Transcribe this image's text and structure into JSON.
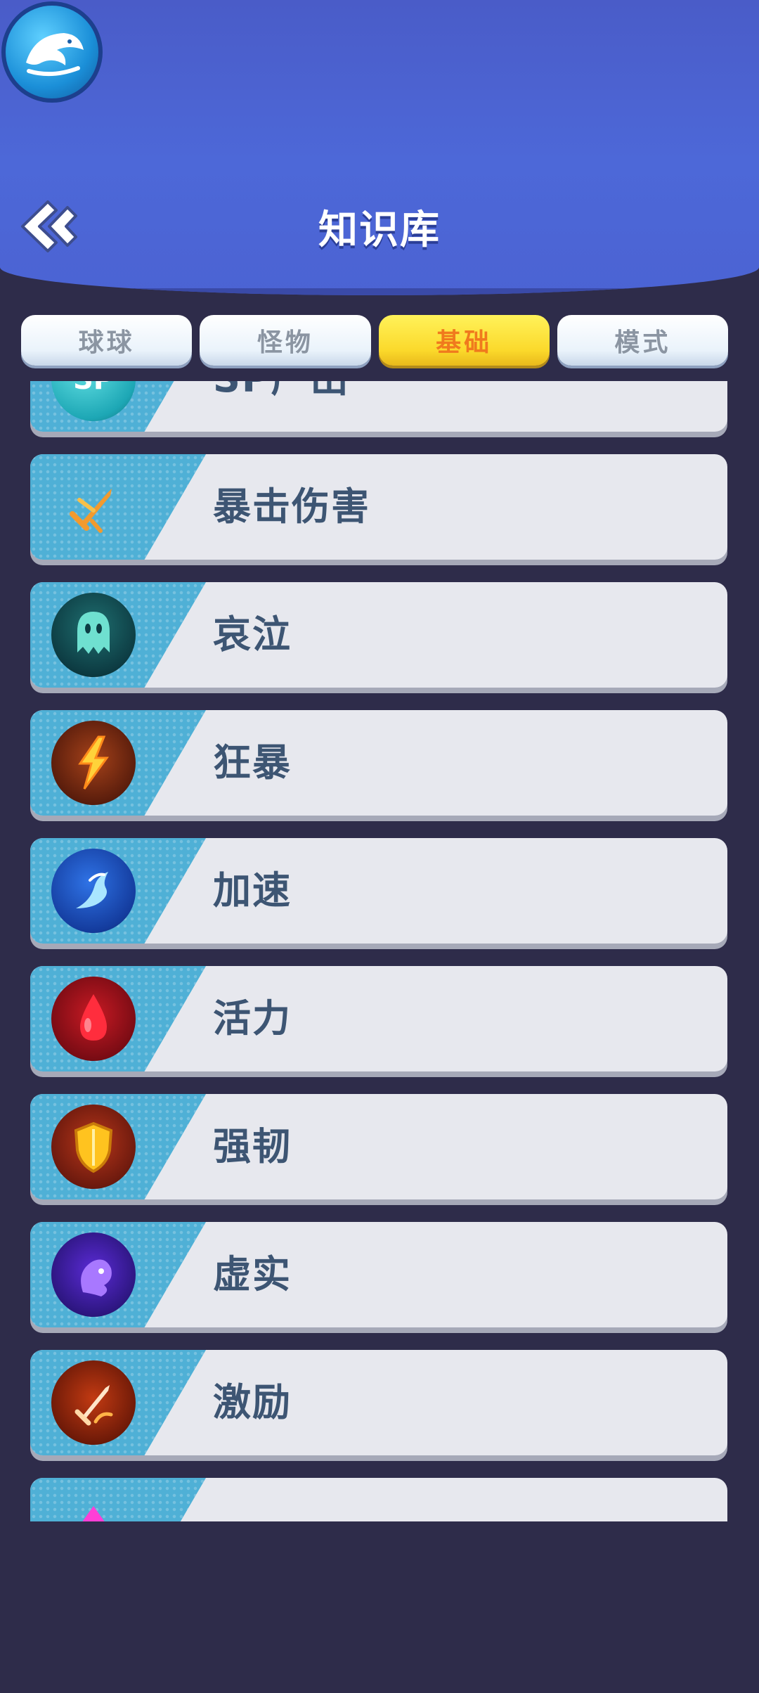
{
  "header": {
    "title": "知识库",
    "app_logo_icon": "whale-logo-icon",
    "back_icon": "double-chevron-left-icon"
  },
  "tabs": [
    {
      "label": "球球",
      "active": false
    },
    {
      "label": "怪物",
      "active": false
    },
    {
      "label": "基础",
      "active": true
    },
    {
      "label": "模式",
      "active": false
    }
  ],
  "colors": {
    "header_blue": "#4d68d8",
    "background": "#2e2c4a",
    "active_tab": "#fbd92b",
    "active_tab_text": "#f07a1d",
    "card": "#e7e8ee",
    "card_accent": "#4fb0d6",
    "item_text": "#3d5573"
  },
  "items": [
    {
      "label": "SP产出",
      "icon": "sp-badge-icon"
    },
    {
      "label": "暴击伤害",
      "icon": "crossed-swords-icon"
    },
    {
      "label": "哀泣",
      "icon": "ghost-icon"
    },
    {
      "label": "狂暴",
      "icon": "lightning-icon"
    },
    {
      "label": "加速",
      "icon": "speed-swirl-icon"
    },
    {
      "label": "活力",
      "icon": "blood-drop-icon"
    },
    {
      "label": "强韧",
      "icon": "shield-icon"
    },
    {
      "label": "虚实",
      "icon": "phantom-icon"
    },
    {
      "label": "激励",
      "icon": "burning-sword-icon"
    },
    {
      "label": "",
      "icon": "pink-triangle-icon"
    }
  ]
}
